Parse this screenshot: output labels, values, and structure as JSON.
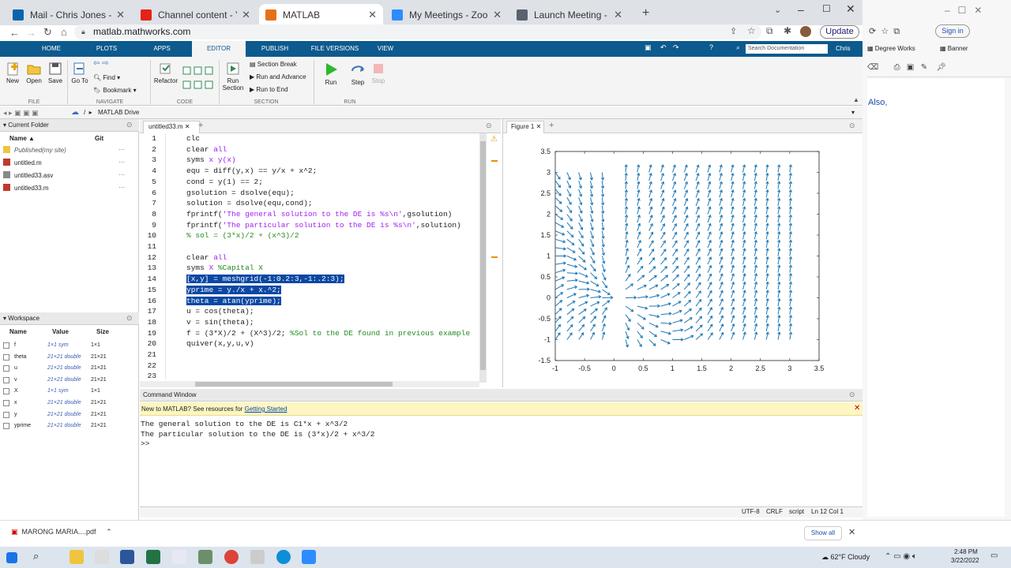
{
  "browser": {
    "tabs": [
      {
        "title": "Mail - Chris Jones - Outlook",
        "color": "#0a64ad"
      },
      {
        "title": "Channel content - YouTube Studio",
        "color": "#e62117"
      },
      {
        "title": "MATLAB",
        "color": "#e3711c"
      },
      {
        "title": "My Meetings - Zoom",
        "color": "#2d8cff"
      },
      {
        "title": "Launch Meeting - Zoom",
        "color": "#5a6270"
      }
    ],
    "url": "matlab.mathworks.com",
    "update_label": "Update"
  },
  "matlab": {
    "tabs": [
      "HOME",
      "PLOTS",
      "APPS",
      "EDITOR",
      "PUBLISH",
      "FILE VERSIONS",
      "VIEW"
    ],
    "search_placeholder": "Search Documentation",
    "user": "Chris",
    "ribbon": {
      "new": "New",
      "open": "Open",
      "save": "Save",
      "goto": "Go To",
      "find": "Find",
      "bookmark": "Bookmark",
      "refactor": "Refactor",
      "run_section": "Run Section",
      "section_break": "Section Break",
      "run_advance": "Run and Advance",
      "run_end": "Run to End",
      "run": "Run",
      "step": "Step",
      "stop": "Stop",
      "sections": {
        "file": "FILE",
        "navigate": "NAVIGATE",
        "code": "CODE",
        "section": "SECTION",
        "run": "RUN"
      }
    },
    "path": "MATLAB Drive",
    "current_folder": {
      "title": "Current Folder",
      "col_name": "Name ▲",
      "col_git": "Git",
      "items": [
        {
          "name": "Published",
          "suffix": "(my site)"
        },
        {
          "name": "untitled.m"
        },
        {
          "name": "untitled33.asv"
        },
        {
          "name": "untitled33.m"
        }
      ]
    },
    "workspace": {
      "title": "Workspace",
      "col_name": "Name",
      "col_value": "Value",
      "col_size": "Size",
      "rows": [
        {
          "name": "f",
          "value": "1×1 sym",
          "size": "1×1"
        },
        {
          "name": "theta",
          "value": "21×21 double",
          "size": "21×21"
        },
        {
          "name": "u",
          "value": "21×21 double",
          "size": "21×21"
        },
        {
          "name": "v",
          "value": "21×21 double",
          "size": "21×21"
        },
        {
          "name": "X",
          "value": "1×1 sym",
          "size": "1×1"
        },
        {
          "name": "x",
          "value": "21×21 double",
          "size": "21×21"
        },
        {
          "name": "y",
          "value": "21×21 double",
          "size": "21×21"
        },
        {
          "name": "yprime",
          "value": "21×21 double",
          "size": "21×21"
        }
      ]
    },
    "editor": {
      "tab": "untitled33.m",
      "lines": [
        "clc",
        "clear all",
        "syms x y(x)",
        "equ = diff(y,x) == y/x + x^2;",
        "cond = y(1) == 2;",
        "gsolution = dsolve(equ);",
        "solution = dsolve(equ,cond);",
        "fprintf('The general solution to the DE is %s\\n',gsolution)",
        "fprintf('The particular solution to the DE is %s\\n',solution)",
        "% sol = (3*x)/2 + (x^3)/2",
        "",
        "clear all",
        "syms X %Capital X",
        "[x,y] = meshgrid(-1:0.2:3,-1:.2:3);",
        "yprime = y./x + x.^2;",
        "theta = atan(yprime);",
        "u = cos(theta);",
        "v = sin(theta);",
        "f = (3*X)/2 + (X^3)/2; %Sol to the DE found in previous example",
        "quiver(x,y,u,v)",
        "",
        "",
        ""
      ]
    },
    "figure": {
      "tab": "Figure 1"
    },
    "command": {
      "title": "Command Window",
      "banner": "New to MATLAB? See resources for",
      "banner_link": "Getting Started",
      "lines": [
        "The general solution to the DE is C1*x + x^3/2",
        "The particular solution to the DE is (3*x)/2 + x^3/2",
        ">>"
      ]
    },
    "status": {
      "encoding": "UTF-8",
      "eol": "CRLF",
      "mode": "script",
      "pos": "Ln 12 Col 1"
    }
  },
  "chart_data": {
    "type": "quiver",
    "x": [
      -1,
      3
    ],
    "y": [
      -1,
      3
    ],
    "step": 0.2,
    "equation": "yprime = y./x + x.^2",
    "xlim": [
      -1,
      3.5
    ],
    "ylim": [
      -1.5,
      3.5
    ],
    "xticks": [
      "-1",
      "-0.5",
      "0",
      "0.5",
      "1",
      "1.5",
      "2",
      "2.5",
      "3",
      "3.5"
    ],
    "yticks": [
      "3.5",
      "3",
      "2.5",
      "2",
      "1.5",
      "1",
      "0.5",
      "0",
      "-0.5",
      "-1",
      "-1.5"
    ],
    "arrow_color": "#1f77b4"
  },
  "download": {
    "file": "MARONG MARIA....pdf",
    "show_all": "Show all"
  },
  "taskbar": {
    "weather": "62°F  Cloudy",
    "time": "2:48 PM",
    "date": "3/22/2022"
  },
  "right_page": {
    "bookmarks": [
      "Degree Works",
      "Banner"
    ],
    "sign_in": "Sign in",
    "text": "Also,"
  }
}
